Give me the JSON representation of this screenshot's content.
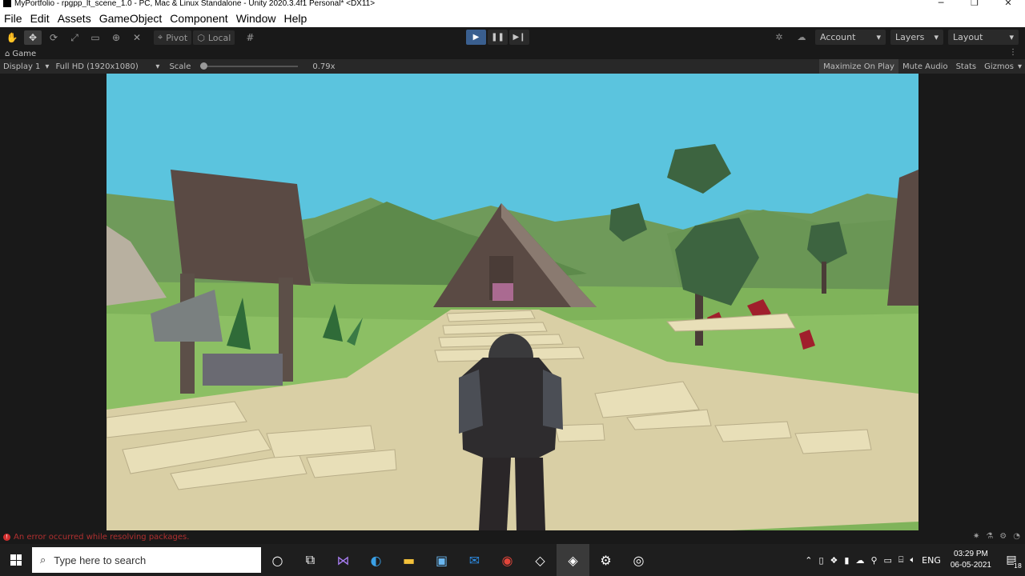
{
  "window": {
    "title": "MyPortfolio - rpgpp_lt_scene_1.0 - PC, Mac & Linux Standalone - Unity 2020.3.4f1 Personal* <DX11>",
    "minimize": "─",
    "maximize": "❐",
    "close": "✕"
  },
  "menu": [
    "File",
    "Edit",
    "Assets",
    "GameObject",
    "Component",
    "Window",
    "Help"
  ],
  "toolbar": {
    "pivot_label": "Pivot",
    "local_label": "Local",
    "account_label": "Account",
    "layers_label": "Layers",
    "layout_label": "Layout"
  },
  "game_tab": {
    "label": "Game"
  },
  "game_bar": {
    "display": "Display 1",
    "resolution": "Full HD (1920x1080)",
    "scale_label": "Scale",
    "scale_value": "0.79x",
    "scale_fraction": 0.0,
    "maximize_on_play": "Maximize On Play",
    "mute_audio": "Mute Audio",
    "stats": "Stats",
    "gizmos": "Gizmos"
  },
  "status": {
    "message": "An error occurred while resolving packages."
  },
  "taskbar": {
    "search_placeholder": "Type here to search",
    "lang": "ENG",
    "time": "03:29 PM",
    "date": "06-05-2021",
    "notification_count": "18"
  },
  "colors": {
    "sky": "#5bc4de",
    "grass": "#7fb35a",
    "hills": "#5f8a4c",
    "wood": "#5a4a44",
    "path": "#e8dfb8",
    "play_active": "#3a5f8f"
  }
}
